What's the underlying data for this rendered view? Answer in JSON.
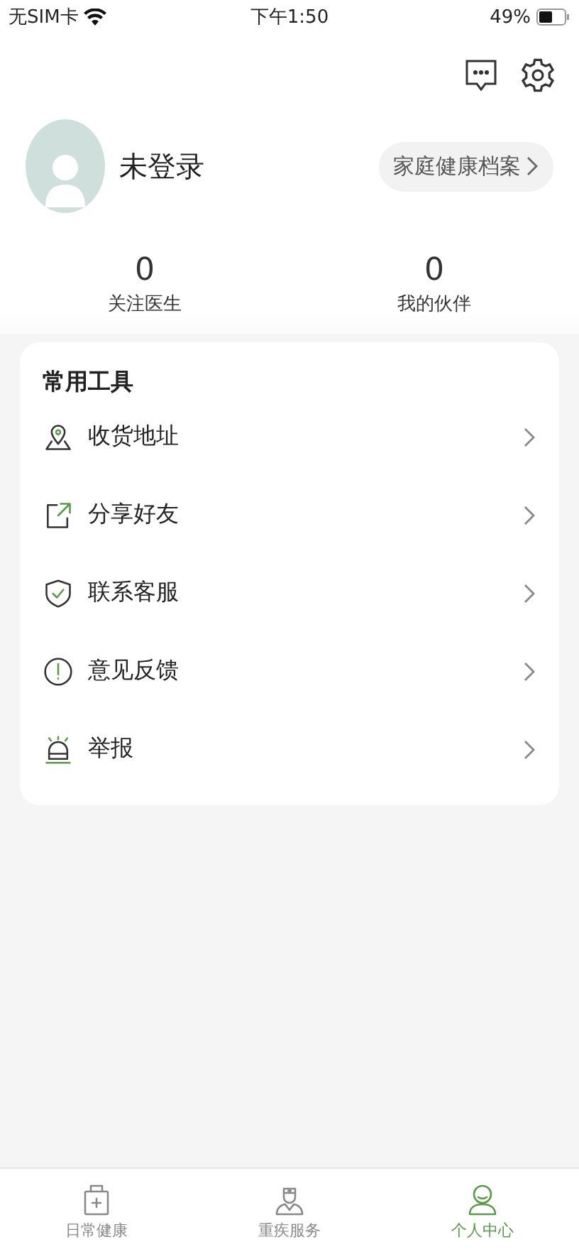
{
  "status_bar": {
    "carrier": "无SIM卡",
    "time": "下午1:50",
    "battery": "49%"
  },
  "profile": {
    "name": "未登录",
    "records_button": "家庭健康档案"
  },
  "stats": [
    {
      "value": "0",
      "label": "关注医生"
    },
    {
      "value": "0",
      "label": "我的伙伴"
    }
  ],
  "tools": {
    "title": "常用工具",
    "items": [
      {
        "label": "收货地址"
      },
      {
        "label": "分享好友"
      },
      {
        "label": "联系客服"
      },
      {
        "label": "意见反馈"
      },
      {
        "label": "举报"
      }
    ]
  },
  "tab_bar": [
    {
      "label": "日常健康",
      "selected": false
    },
    {
      "label": "重疾服务",
      "selected": false
    },
    {
      "label": "个人中心",
      "selected": true
    }
  ]
}
